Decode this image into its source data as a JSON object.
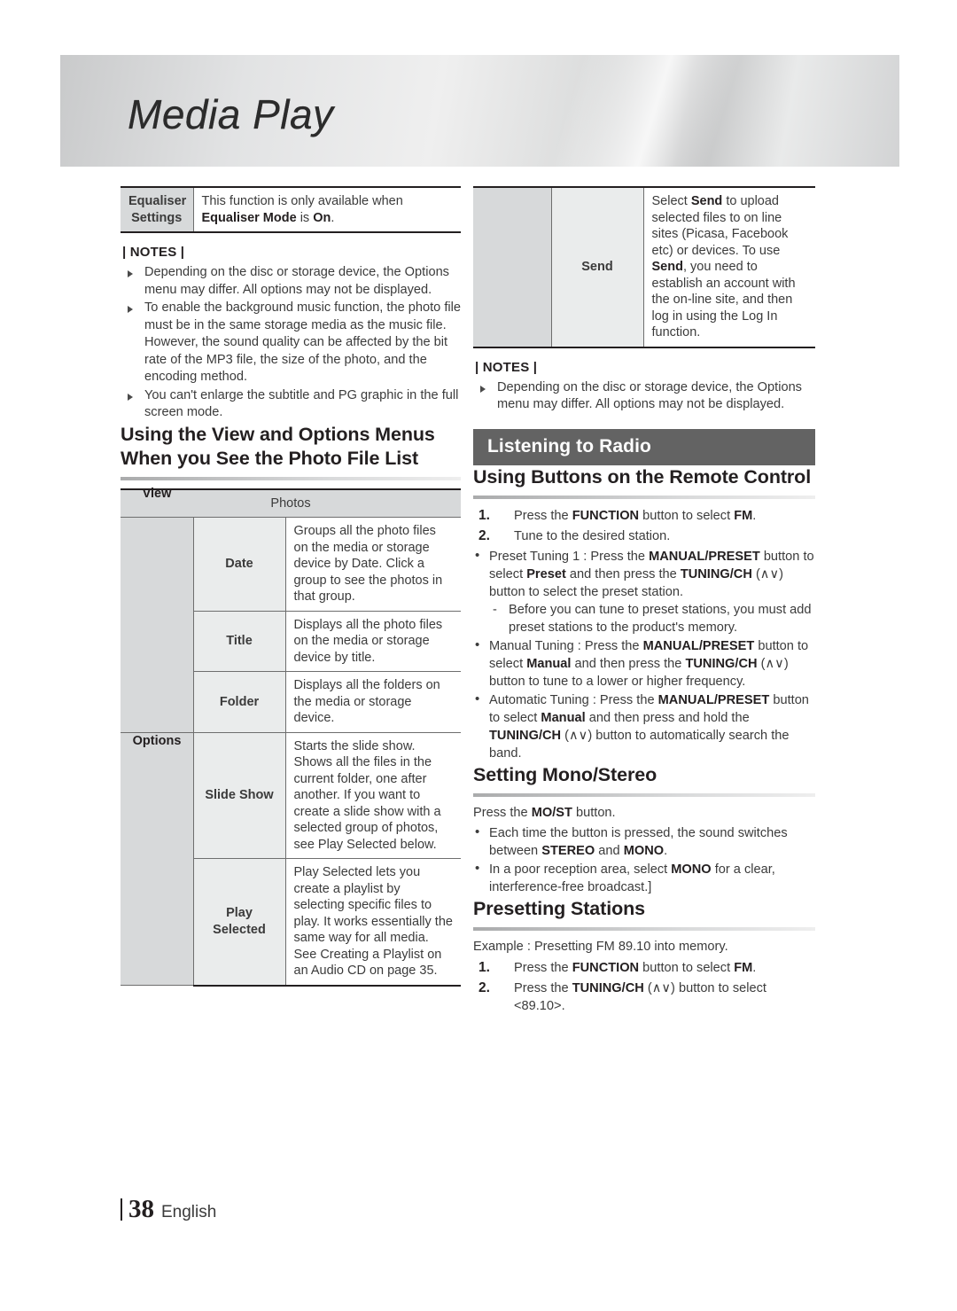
{
  "page": {
    "chapter_title": "Media Play",
    "page_number": "38",
    "language": "English"
  },
  "left_column": {
    "equaliser_table": {
      "rows": [
        {
          "label": "Equaliser Settings",
          "description_plain": "This function is only available when Equaliser Mode is On."
        }
      ]
    },
    "notes": {
      "title": "| NOTES |",
      "items": [
        "Depending on the disc or storage device, the Options menu may differ. All options may not be displayed.",
        "To enable the background music function, the photo file must be in the same storage media as the music file. However, the sound quality can be affected by the bit rate of the MP3 file, the size of the photo, and the encoding method.",
        "You can't enlarge the subtitle and PG graphic in the full screen mode."
      ]
    },
    "heading": "Using the View and Options Menus When you See the Photo File List",
    "photos_table": {
      "header": "Photos",
      "groups": [
        {
          "name": "View",
          "rows": [
            {
              "label": "Date",
              "description": "Groups all the photo files on the media or storage device by Date. Click a group to see the photos in that group."
            },
            {
              "label": "Title",
              "description": "Displays all the photo files on the media or storage device by title."
            },
            {
              "label": "Folder",
              "description": "Displays all the folders on the media or storage device."
            }
          ]
        },
        {
          "name": "Options",
          "rows": [
            {
              "label": "Slide Show",
              "description": "Starts the slide show. Shows all the files in the current folder, one after another. If you want to create a slide show with a selected group of photos, see Play Selected below."
            },
            {
              "label": "Play Selected",
              "description": "Play Selected lets you create a playlist by selecting specific files to play. It works essentially the same way for all media. See Creating a Playlist on an Audio CD on page 35."
            }
          ]
        }
      ]
    }
  },
  "right_column": {
    "send_table": {
      "rows": [
        {
          "label": "Send",
          "description_plain": "Select Send to upload selected files to on line sites (Picasa, Facebook etc) or devices. To use Send, you need to establish an account with the on-line site, and then log in using the Log In function."
        }
      ]
    },
    "notes": {
      "title": "| NOTES |",
      "items": [
        "Depending on the disc or storage device, the Options menu may differ. All options may not be displayed."
      ]
    },
    "section_bar": "Listening to Radio",
    "remote_control": {
      "heading": "Using Buttons on the Remote Control",
      "steps": [
        {
          "num": "1.",
          "text_plain": "Press the FUNCTION button to select FM."
        },
        {
          "num": "2.",
          "text_plain": "Tune to the desired station."
        }
      ],
      "bullets": [
        {
          "text_plain": "Preset Tuning 1 : Press the MANUAL/PRESET button to select Preset and then press the TUNING/CH (∧∨) button to select the preset station.",
          "sub": [
            "Before you can tune to preset stations, you must add preset stations to the product's memory."
          ]
        },
        {
          "text_plain": "Manual Tuning : Press the MANUAL/PRESET button to select Manual and then press the TUNING/CH (∧∨) button to tune to a lower or higher frequency.",
          "sub": []
        },
        {
          "text_plain": "Automatic Tuning : Press the MANUAL/PRESET button to select Manual and then press and hold the TUNING/CH (∧∨) button to automatically search the band.",
          "sub": []
        }
      ]
    },
    "mono_stereo": {
      "heading": "Setting Mono/Stereo",
      "intro_plain": "Press the MO/ST button.",
      "bullets": [
        "Each time the button is pressed, the sound switches between STEREO and MONO.",
        "In a poor reception area, select MONO for a clear, interference-free broadcast.]"
      ]
    },
    "presetting": {
      "heading": "Presetting Stations",
      "example": "Example : Presetting FM 89.10 into memory.",
      "steps": [
        {
          "num": "1.",
          "text_plain": "Press the FUNCTION button to select FM."
        },
        {
          "num": "2.",
          "text_plain": "Press the TUNING/CH (∧∨) button to select <89.10>."
        }
      ]
    }
  },
  "colors": {
    "bar_background": "#636363",
    "label_dark": "#d7d9da",
    "label_light": "#eaecec",
    "text": "#3b3b3b",
    "heading": "#231f20"
  }
}
